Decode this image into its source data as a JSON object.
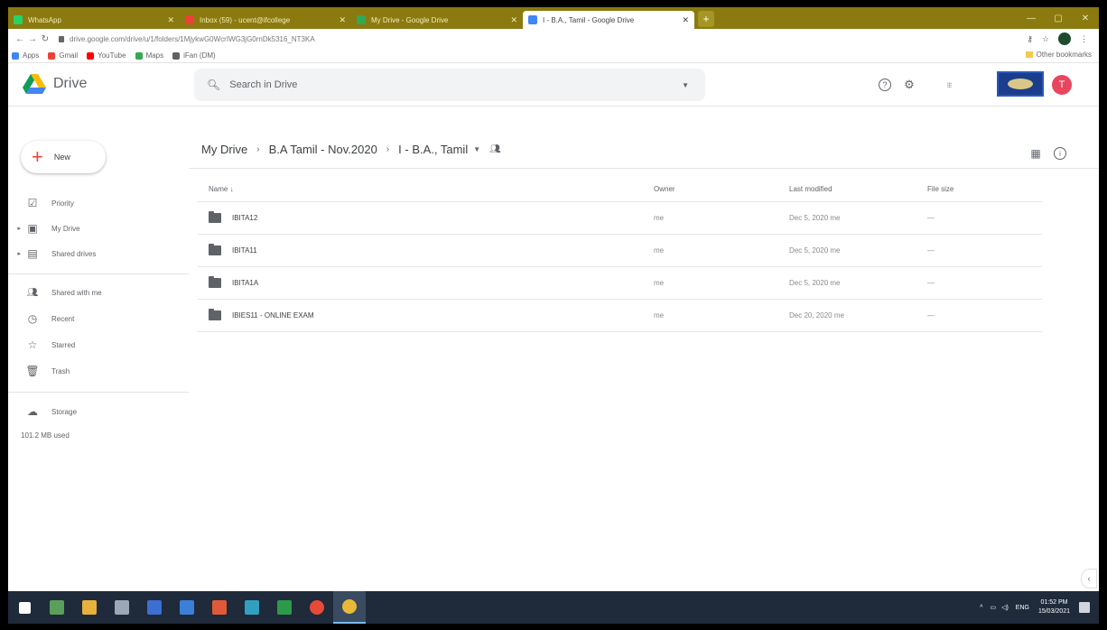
{
  "browser": {
    "tabs": [
      {
        "title": "WhatsApp",
        "color": "#25d366",
        "active": false
      },
      {
        "title": "Inbox (59) - ucent@ifcollege",
        "color": "#ea4335",
        "active": false
      },
      {
        "title": "My Drive - Google Drive",
        "color": "#34a853",
        "active": false
      },
      {
        "title": "I - B.A., Tamil - Google Drive",
        "color": "#4285f4",
        "active": true
      }
    ],
    "new_tab": "+",
    "window_controls": [
      "—",
      "▢",
      "✕"
    ],
    "url": "drive.google.com/drive/u/1/folders/1MjykwG0WcrIWG3jG0rnDk5316_NT3KA",
    "bookmarks": [
      {
        "label": "Apps",
        "color": "#4285f4"
      },
      {
        "label": "Gmail",
        "color": "#ea4335"
      },
      {
        "label": "YouTube",
        "color": "#ff0000"
      },
      {
        "label": "Maps",
        "color": "#34a853"
      },
      {
        "label": "iFan (DM)",
        "color": "#5f6368"
      }
    ],
    "other_bookmarks": "Other bookmarks"
  },
  "header": {
    "app_name": "Drive",
    "search_placeholder": "Search in Drive",
    "help_icon": "?",
    "settings_icon": "⚙",
    "apps_icon": "⋮⋮⋮",
    "avatar_initial": "T"
  },
  "sidebar": {
    "new_label": "New",
    "items": [
      {
        "label": "Priority",
        "icon": "☑",
        "arrow": ""
      },
      {
        "label": "My Drive",
        "icon": "▣",
        "arrow": "▸"
      },
      {
        "label": "Shared drives",
        "icon": "▤",
        "arrow": "▸"
      },
      {
        "label": "Shared with me",
        "icon": "👥",
        "arrow": ""
      },
      {
        "label": "Recent",
        "icon": "◷",
        "arrow": ""
      },
      {
        "label": "Starred",
        "icon": "☆",
        "arrow": ""
      },
      {
        "label": "Trash",
        "icon": "🗑",
        "arrow": ""
      }
    ],
    "storage_label": "Storage",
    "storage_used": "101.2 MB used"
  },
  "breadcrumb": {
    "items": [
      "My Drive",
      "B.A Tamil - Nov.2020",
      "I - B.A., Tamil"
    ],
    "separator": "›"
  },
  "table": {
    "headers": {
      "name": "Name ↓",
      "owner": "Owner",
      "modified": "Last modified",
      "size": "File size"
    },
    "rows": [
      {
        "name": "IBITA12",
        "owner": "me",
        "modified": "Dec 5, 2020 me",
        "size": "—"
      },
      {
        "name": "IBITA11",
        "owner": "me",
        "modified": "Dec 5, 2020 me",
        "size": "—"
      },
      {
        "name": "IBITA1A",
        "owner": "me",
        "modified": "Dec 5, 2020 me",
        "size": "—"
      },
      {
        "name": "IBIES11 - ONLINE EXAM",
        "owner": "me",
        "modified": "Dec 20, 2020 me",
        "size": "—"
      }
    ]
  },
  "taskbar": {
    "icons": [
      {
        "name": "start",
        "color": "#ffffff"
      },
      {
        "name": "app-1",
        "color": "#5aa05a"
      },
      {
        "name": "file-explorer",
        "color": "#e6b13d"
      },
      {
        "name": "app-3",
        "color": "#9aa8b8"
      },
      {
        "name": "app-4",
        "color": "#3b6fd1"
      },
      {
        "name": "app-5",
        "color": "#3c7fd8"
      },
      {
        "name": "app-6",
        "color": "#e05a3a"
      },
      {
        "name": "app-7",
        "color": "#30a0c0"
      },
      {
        "name": "app-8",
        "color": "#2d9a4a"
      },
      {
        "name": "app-9",
        "color": "#e84a3a"
      },
      {
        "name": "chrome",
        "color": "#e8b83a"
      }
    ],
    "language": "ENG",
    "time": "01:52 PM",
    "date": "15/03/2021"
  }
}
